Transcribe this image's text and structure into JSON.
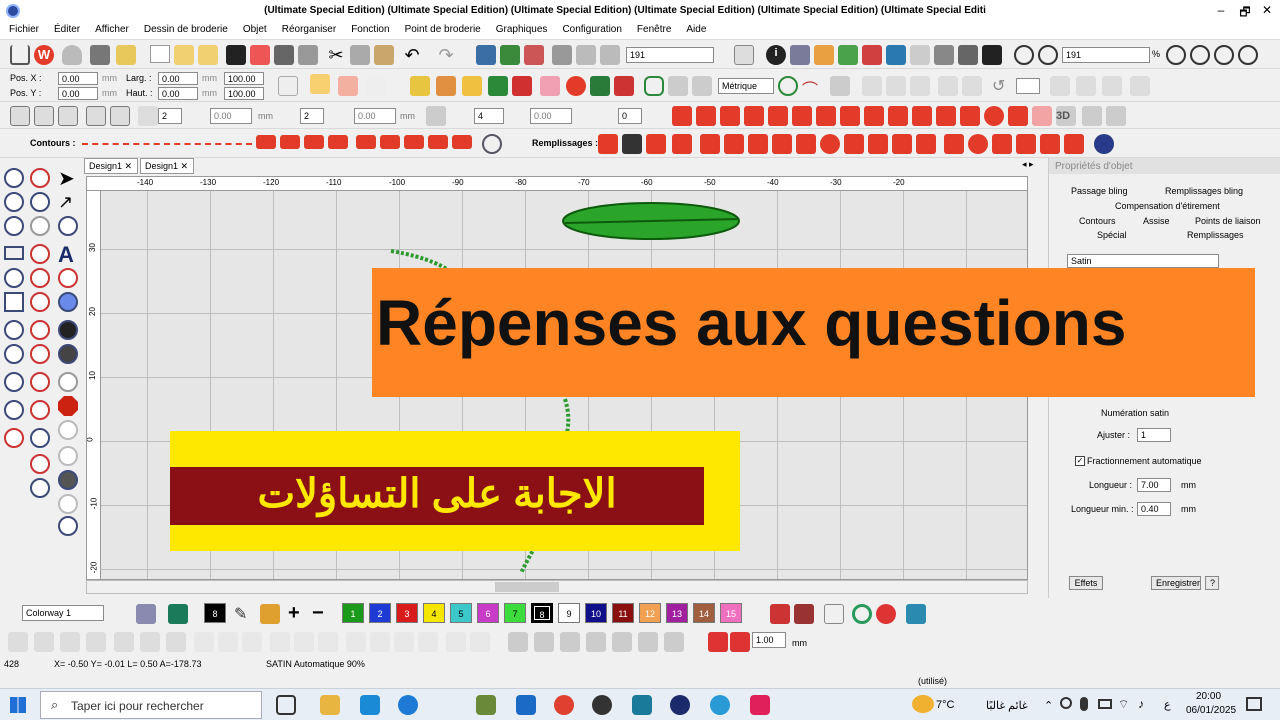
{
  "window": {
    "title": "(Ultimate Special Edition) (Ultimate Special Edition) (Ultimate Special Edition) (Ultimate Special Edition) (Ultimate Special Edition) (Ultimate Special Editi",
    "min": "–",
    "restore": "🗗",
    "close": "✕"
  },
  "menu": [
    "Fichier",
    "Éditer",
    "Afficher",
    "Dessin de broderie",
    "Objet",
    "Réorganiser",
    "Fonction",
    "Point de broderie",
    "Graphiques",
    "Configuration",
    "Fenêtre",
    "Aide"
  ],
  "toolbar1": {
    "zoom1": "191",
    "zoom2": "191",
    "pct": "%"
  },
  "toolbar2": {
    "posx_label": "Pos. X :",
    "posy_label": "Pos. Y :",
    "posx": "0.00",
    "posy": "0.00",
    "unit": "mm",
    "larg_label": "Larg. :",
    "haut_label": "Haut. :",
    "larg": "0.00",
    "haut": "0.00",
    "pct1": "100.00",
    "pct2": "100.00",
    "metric": "Métrique"
  },
  "toolbar3": {
    "v1": "2",
    "v2": "0.00",
    "v3": "2",
    "v4": "0.00",
    "v5": "4",
    "v6": "0.00",
    "v7": "0",
    "mm": "mm"
  },
  "toolbar4": {
    "contours": "Contours :",
    "remplissages": "Remplissages :"
  },
  "tabs": [
    "Design1",
    "Design1"
  ],
  "ruler_top": [
    "-140",
    "-130",
    "-120",
    "-110",
    "-100",
    "-90",
    "-80",
    "-70",
    "-60",
    "-50",
    "-40",
    "-30",
    "-20"
  ],
  "ruler_left": [
    "30",
    "20",
    "10",
    "0",
    "-10",
    "-20"
  ],
  "panel": {
    "title": "Propriétés d'objet",
    "tab1": "Passage bling",
    "tab2": "Remplissages bling",
    "tab3": "Compensation d'étirement",
    "tab4": "Contours",
    "tab5": "Assise",
    "tab6": "Points de liaison",
    "tab7": "Spécial",
    "tab8": "Remplissages",
    "type": "Satin",
    "num": "Numération satin",
    "ajuster_label": "Ajuster :",
    "ajuster": "1",
    "frac": "Fractionnement automatique",
    "longueur_label": "Longueur :",
    "longueur": "7.00",
    "longmin_label": "Longueur min. :",
    "longmin": "0.40",
    "mm": "mm",
    "effets": "Effets",
    "enregistrer": "Enregistrer",
    "help": "?"
  },
  "overlay": {
    "french": "Répenses aux questions",
    "arabic": "الاجابة على التساؤلات"
  },
  "colorbar": {
    "colorway": "Colorway 1",
    "selected": "8",
    "swatches": [
      "1",
      "2",
      "3",
      "4",
      "5",
      "6",
      "7",
      "8",
      "9",
      "10",
      "11",
      "12",
      "13",
      "14",
      "15"
    ],
    "swatch_colors": [
      "#1a9a1a",
      "#1f3bd6",
      "#d81b1b",
      "#f5e600",
      "#3cc8c8",
      "#c83cc8",
      "#3cdc3c",
      "#000000",
      "#ffffff",
      "#10108a",
      "#8a1010",
      "#f0a050",
      "#a020a0",
      "#a06040",
      "#f070c0"
    ]
  },
  "bottom": {
    "thick": "1.00",
    "mm": "mm"
  },
  "status": {
    "count": "428",
    "coords": "X=  -0.50 Y=  -0.01 L=   0.50 A=-178.73",
    "mode": "SATIN Automatique 90%",
    "used": "(utilisé)"
  },
  "taskbar": {
    "search": "Taper ici pour rechercher",
    "temp": "7°C",
    "weather": "غائم غالبًا",
    "lang": "ع",
    "time": "20:00",
    "date": "06/01/2025"
  }
}
